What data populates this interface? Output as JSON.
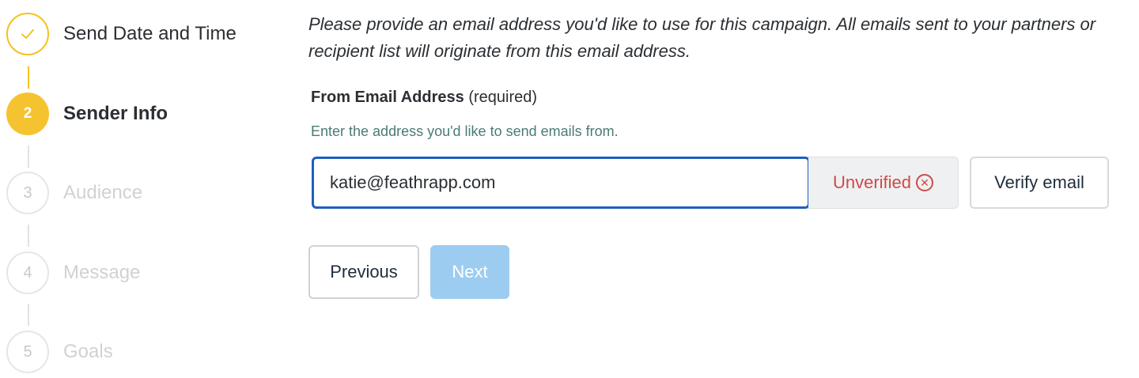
{
  "stepper": {
    "steps": [
      {
        "number": "",
        "label": "Send Date and Time",
        "state": "complete",
        "icon": "check-icon"
      },
      {
        "number": "2",
        "label": "Sender Info",
        "state": "current"
      },
      {
        "number": "3",
        "label": "Audience",
        "state": "upcoming"
      },
      {
        "number": "4",
        "label": "Message",
        "state": "upcoming"
      },
      {
        "number": "5",
        "label": "Goals",
        "state": "upcoming"
      }
    ]
  },
  "sender_info": {
    "intro": "Please provide an email address you'd like to use for this campaign. All emails sent to your partners or recipient list will originate from this email address.",
    "field_label": "From Email Address",
    "field_required": "(required)",
    "hint": "Enter the address you'd like to send emails from.",
    "email_value": "katie@feathrapp.com",
    "status_text": "Unverified",
    "status_icon": "circle-x-icon",
    "verify_label": "Verify email"
  },
  "actions": {
    "previous_label": "Previous",
    "next_label": "Next"
  },
  "colors": {
    "accent_yellow": "#f6c330",
    "focus_blue": "#1f5fbf",
    "error_red": "#cf4a4a",
    "hint_teal": "#4a7c74",
    "next_disabled_blue": "#9ccdf1"
  }
}
